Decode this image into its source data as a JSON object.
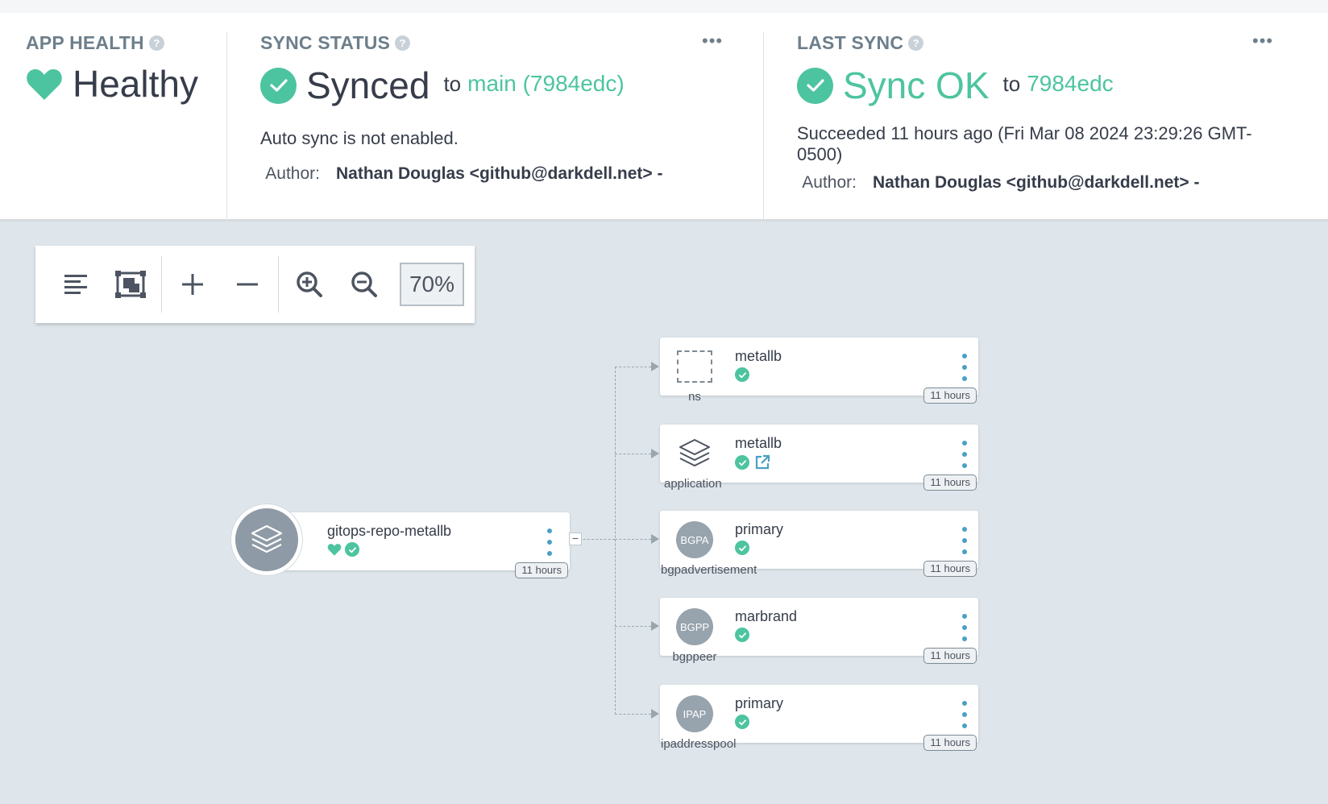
{
  "app_health": {
    "title": "APP HEALTH",
    "status": "Healthy"
  },
  "sync_status": {
    "title": "SYNC STATUS",
    "status": "Synced",
    "to_label": "to",
    "target": "main (7984edc)",
    "message": "Auto sync is not enabled.",
    "author_label": "Author:",
    "author": "Nathan Douglas <github@darkdell.net> -"
  },
  "last_sync": {
    "title": "LAST SYNC",
    "status": "Sync OK",
    "to_label": "to",
    "target": "7984edc",
    "message": "Succeeded 11 hours ago (Fri Mar 08 2024 23:29:26 GMT-0500)",
    "author_label": "Author:",
    "author": "Nathan Douglas <github@darkdell.net> -"
  },
  "toolbar": {
    "zoom": "70%"
  },
  "graph": {
    "root": {
      "name": "gitops-repo-metallb",
      "age": "11 hours"
    },
    "children": [
      {
        "kind": "ns",
        "name": "metallb",
        "age": "11 hours",
        "icon": "namespace-icon"
      },
      {
        "kind": "application",
        "name": "metallb",
        "age": "11 hours",
        "icon": "layers-icon"
      },
      {
        "kind": "bgpadvertisement",
        "abbr": "BGPA",
        "name": "primary",
        "age": "11 hours"
      },
      {
        "kind": "bgppeer",
        "abbr": "BGPP",
        "name": "marbrand",
        "age": "11 hours"
      },
      {
        "kind": "ipaddresspool",
        "abbr": "IPAP",
        "name": "primary",
        "age": "11 hours"
      }
    ]
  },
  "colors": {
    "accent": "#4dc4a0",
    "menu": "#4aa0c4",
    "background": "#dee6eb"
  }
}
